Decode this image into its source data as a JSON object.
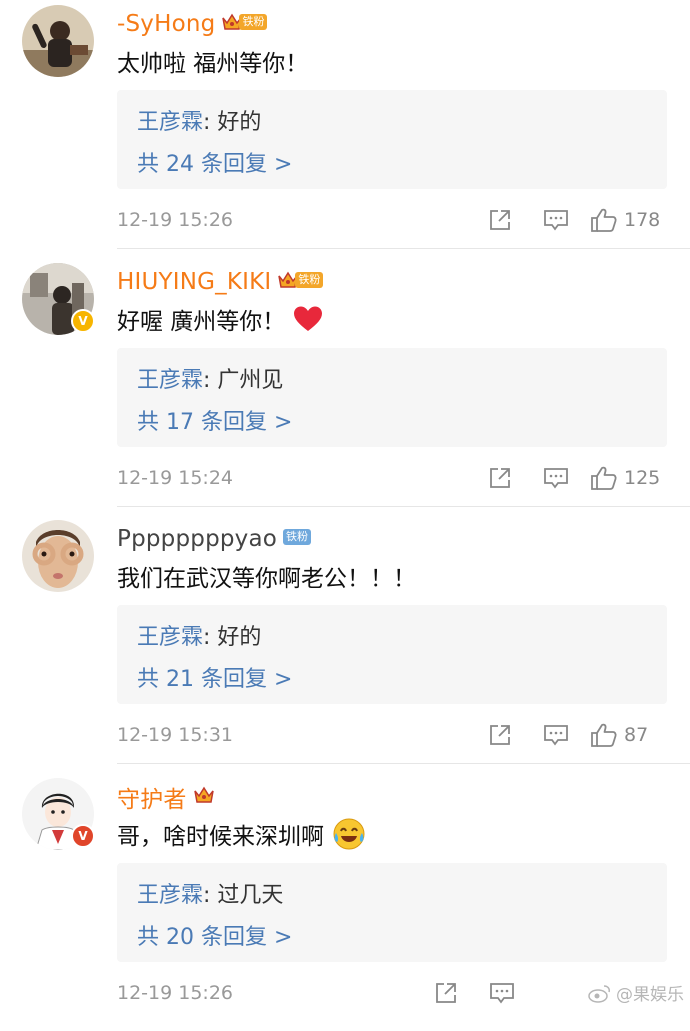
{
  "comments": [
    {
      "username": "-SyHong",
      "badge": "铁粉",
      "content": "太帅啦 福州等你！",
      "reply": {
        "author": "王彦霖",
        "separator": ": ",
        "text": "好的"
      },
      "reply_count": "共 24 条回复 >",
      "time": "12-19 15:26",
      "likes": "178"
    },
    {
      "username": "HIUYING_KIKI",
      "badge": "铁粉",
      "content": "好喔 廣州等你！",
      "reply": {
        "author": "王彦霖",
        "separator": ": ",
        "text": "广州见"
      },
      "reply_count": "共 17 条回复 >",
      "time": "12-19 15:24",
      "likes": "125"
    },
    {
      "username": "Ppppppppyao",
      "badge": "铁粉",
      "content": "我们在武汉等你啊老公！！！",
      "reply": {
        "author": "王彦霖",
        "separator": ": ",
        "text": "好的"
      },
      "reply_count": "共 21 条回复 >",
      "time": "12-19 15:31",
      "likes": "87"
    },
    {
      "username": "守护者",
      "badge": "",
      "content": "哥，啥时候来深圳啊",
      "reply": {
        "author": "王彦霖",
        "separator": ": ",
        "text": "过几天"
      },
      "reply_count": "共 20 条回复 >",
      "time": "12-19 15:26",
      "likes": ""
    }
  ],
  "verified_badge": "V",
  "watermark": "@果娱乐",
  "colors": {
    "username_accent": "#f57b17",
    "reply_link": "#4a7ab5",
    "meta_gray": "#999999",
    "reply_bg": "#f6f6f6",
    "heart": "#e8283b"
  },
  "icons": [
    "share-icon",
    "comment-icon",
    "like-icon",
    "crown-icon",
    "heart-icon",
    "laugh-cry-emoji",
    "weibo-icon"
  ]
}
